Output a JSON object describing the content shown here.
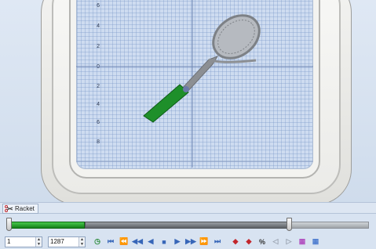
{
  "ruler": {
    "labels": [
      "6",
      "4",
      "2",
      "0",
      "2",
      "4",
      "6",
      "8"
    ]
  },
  "design": {
    "tab_label": "Racket",
    "colors": {
      "handle": "#1e8f2a",
      "frame": "#8c8f93",
      "strings": "#7d8186"
    }
  },
  "stitch_slider": {
    "sewn_fraction": 0.21,
    "end_fraction": 0.78,
    "colors": {
      "sewn": "#2aa831",
      "remaining": "#777b80"
    }
  },
  "toolbar": {
    "start_stitch": "1",
    "end_stitch": "1287",
    "icons": [
      "stitch-timer-icon",
      "first-stitch-icon",
      "back-fast-icon",
      "back-icon",
      "back-step-icon",
      "stop-icon",
      "play-icon",
      "forward-icon",
      "forward-fast-icon",
      "last-stitch-icon",
      "color-back-icon",
      "color-forward-icon",
      "trim-jump-icon",
      "object-back-icon",
      "object-forward-icon",
      "color-palette-icon",
      "thread-chart-icon"
    ]
  }
}
